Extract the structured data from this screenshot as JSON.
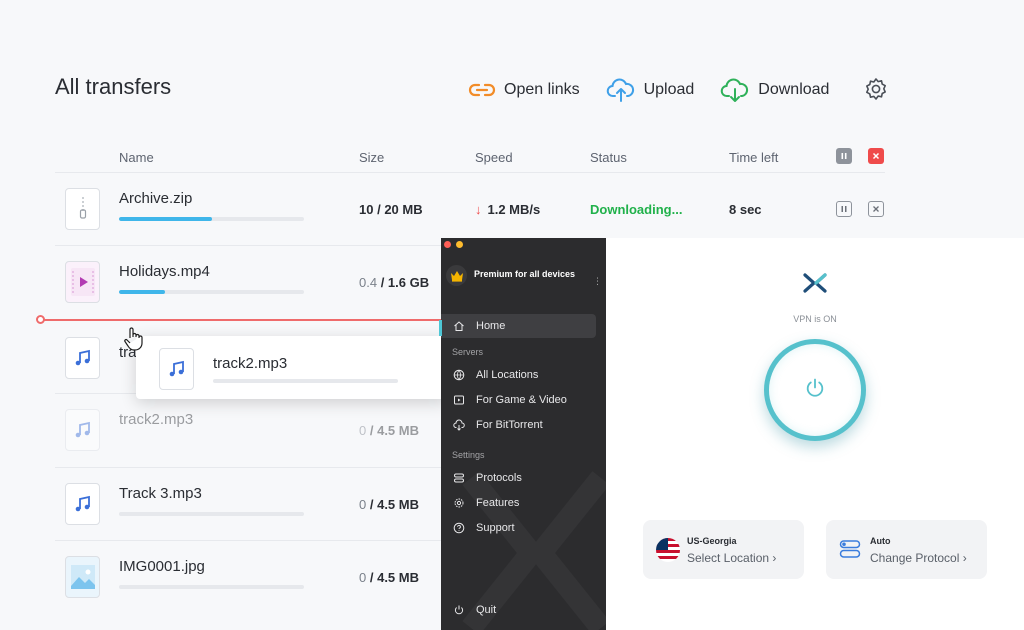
{
  "transfers": {
    "title": "All transfers",
    "toolbar": {
      "open_links": "Open links",
      "upload": "Upload",
      "download": "Download"
    },
    "columns": {
      "name": "Name",
      "size": "Size",
      "speed": "Speed",
      "status": "Status",
      "time_left": "Time left"
    },
    "rows": [
      {
        "name": "Archive.zip",
        "size_done": "10",
        "size_total": "/ 20 MB",
        "speed": "1.2 MB/s",
        "status": "Downloading...",
        "time_left": "8 sec",
        "progress": 0.5,
        "icon": "zip-file-icon"
      },
      {
        "name": "Holidays.mp4",
        "size_done": "0.4",
        "size_total": "/ 1.6 GB",
        "progress": 0.25,
        "icon": "video-file-icon"
      },
      {
        "name": "tra",
        "icon": "audio-file-icon"
      },
      {
        "name": "track2.mp3",
        "size_done": "0",
        "size_total": "/ 4.5 MB",
        "icon": "audio-file-icon"
      },
      {
        "name": "Track 3.mp3",
        "size_done": "0",
        "size_total": "/ 4.5 MB",
        "progress": 0,
        "icon": "audio-file-icon"
      },
      {
        "name": "IMG0001.jpg",
        "size_done": "0",
        "size_total": "/ 4.5 MB",
        "progress": 0,
        "icon": "image-file-icon"
      }
    ],
    "dragging": {
      "name": "track2.mp3",
      "progress": 0
    },
    "colors": {
      "progress": "#3fb6ea",
      "status_ok": "#20b14a",
      "accent_red": "#ef4b4b"
    }
  },
  "vpn": {
    "premium_text": "Premium for all devices",
    "menu": {
      "home": "Home",
      "servers_section": "Servers",
      "all_locations": "All Locations",
      "game_video": "For Game & Video",
      "bittorrent": "For BitTorrent",
      "settings_section": "Settings",
      "protocols": "Protocols",
      "features": "Features",
      "support": "Support",
      "quit": "Quit"
    },
    "status": "VPN is ON",
    "location_card": {
      "title": "US-Georgia",
      "action": "Select Location"
    },
    "protocol_card": {
      "title": "Auto",
      "action": "Change Protocol"
    },
    "colors": {
      "accent": "#56c1cc",
      "sidebar": "#2c2c2e"
    }
  }
}
